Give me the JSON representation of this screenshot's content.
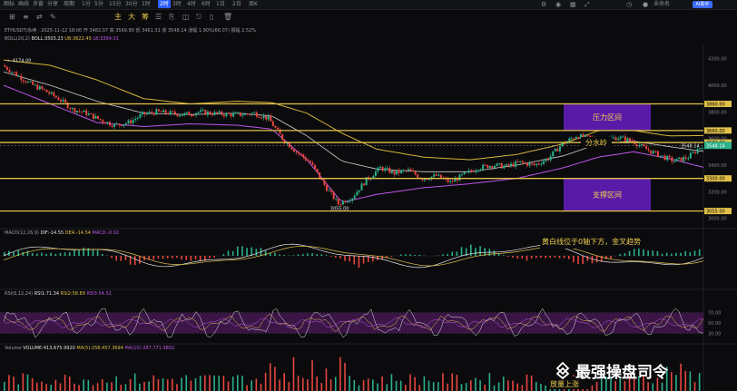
{
  "toolbar": {
    "items": [
      "图标",
      "画线",
      "多窗",
      "分享",
      "周期",
      "1分",
      "5分",
      "15分",
      "30分",
      "1时",
      "2时",
      "3时",
      "4时",
      "6时",
      "1日",
      "2日",
      "周K"
    ],
    "selected_index": 10,
    "account_label": "未命名",
    "chip_label": "AI助手"
  },
  "icon_bar": [
    "⊞",
    "≡",
    "⇄",
    "✎",
    "主",
    "大",
    "筹",
    "☰",
    "⎘",
    "◫",
    "⎋",
    "▯",
    "🗑"
  ],
  "legend": {
    "main_line": "ETHUSDT/永续 · 2025-11-12 18:00  开 3482.07  高 3569.80  低 3461.31  收 3548.14  涨幅 1.90%(66.07)  振幅 2.52%",
    "boll_name": "BOLL(20,2)",
    "boll_mid": "BOLL:3503.23",
    "boll_up": "UB:3622.45",
    "boll_dn": "LB:3384.01",
    "macd_name": "MACD(12,26,9)",
    "macd_dif": "DIF:-14.55",
    "macd_dea": "DEA:-14.54",
    "macd_hist": "MACD:-0.02",
    "rsi_name": "RSI(6,12,24)",
    "rsi1": "RSI1:71.34",
    "rsi2": "RSI2:58.89",
    "rsi3": "RSI3:54.52",
    "vol_name": "Volume",
    "vol_main": "VOLUME:413,675.9920",
    "vol_ma1": "MA(5):258,457.3694",
    "vol_ma2": "MA(10):287,771.9802"
  },
  "annotations": {
    "resistance_zone": "压力区间",
    "watershed": "分水岭",
    "support_zone": "支撑区间",
    "macd_note": "黄白线位于0轴下方，金叉趋势",
    "volume_note": "放量上涨",
    "high_label": "4174.00",
    "low_label": "3055.00"
  },
  "price_axis": {
    "ticks": [
      "4200.00",
      "4000.00",
      "3800.00",
      "3600.00",
      "3400.00",
      "3200.00",
      "3000.00"
    ],
    "level_labels": [
      "3860.00",
      "3660.00",
      "3570.00",
      "3300.00",
      "3055.00"
    ],
    "current_price": "3548.14",
    "current_marker": "3548.14"
  },
  "rsi_axis": {
    "ticks": [
      "70.00",
      "50.00",
      "30.00"
    ]
  },
  "watermark": "最强操盘司令",
  "colors": {
    "up": "#2bb08a",
    "down": "#e8463f",
    "level": "#e2c14a",
    "zone": "#5a1aa8",
    "boll_mid": "#d0d0d0",
    "boll_band": "#d4b43a",
    "boll_lb": "#c055e8",
    "rsi_band": "#3a1546"
  },
  "chart_data": {
    "type": "candlestick",
    "title": "ETHUSDT/永续",
    "ylim": [
      2950,
      4300
    ],
    "levels": [
      3860,
      3660,
      3570,
      3300,
      3055
    ],
    "resistance_zone": [
      3660,
      3860
    ],
    "support_zone": [
      3055,
      3300
    ],
    "watershed": 3570,
    "current_price": 3548.14,
    "trend_close": [
      [
        0,
        4150
      ],
      [
        6,
        4080
      ],
      [
        12,
        4010
      ],
      [
        18,
        3960
      ],
      [
        24,
        3900
      ],
      [
        30,
        3820
      ],
      [
        36,
        3790
      ],
      [
        42,
        3740
      ],
      [
        48,
        3700
      ],
      [
        54,
        3720
      ],
      [
        60,
        3780
      ],
      [
        66,
        3800
      ],
      [
        72,
        3790
      ],
      [
        78,
        3780
      ],
      [
        84,
        3800
      ],
      [
        90,
        3790
      ],
      [
        96,
        3780
      ],
      [
        102,
        3780
      ],
      [
        108,
        3790
      ],
      [
        114,
        3750
      ],
      [
        120,
        3600
      ],
      [
        126,
        3500
      ],
      [
        132,
        3420
      ],
      [
        138,
        3250
      ],
      [
        144,
        3110
      ],
      [
        150,
        3160
      ],
      [
        156,
        3290
      ],
      [
        162,
        3380
      ],
      [
        168,
        3340
      ],
      [
        174,
        3360
      ],
      [
        180,
        3300
      ],
      [
        186,
        3320
      ],
      [
        192,
        3270
      ],
      [
        198,
        3330
      ],
      [
        204,
        3380
      ],
      [
        210,
        3400
      ],
      [
        216,
        3390
      ],
      [
        222,
        3420
      ],
      [
        228,
        3400
      ],
      [
        234,
        3450
      ],
      [
        240,
        3560
      ],
      [
        246,
        3620
      ],
      [
        252,
        3600
      ],
      [
        258,
        3590
      ],
      [
        264,
        3610
      ],
      [
        270,
        3580
      ],
      [
        276,
        3520
      ],
      [
        282,
        3470
      ],
      [
        288,
        3430
      ],
      [
        294,
        3460
      ],
      [
        300,
        3548
      ]
    ],
    "boll_ub_trend": [
      [
        0,
        4190
      ],
      [
        20,
        4150
      ],
      [
        40,
        4040
      ],
      [
        60,
        3900
      ],
      [
        80,
        3860
      ],
      [
        100,
        3880
      ],
      [
        115,
        3870
      ],
      [
        130,
        3790
      ],
      [
        145,
        3640
      ],
      [
        160,
        3520
      ],
      [
        180,
        3460
      ],
      [
        200,
        3440
      ],
      [
        220,
        3480
      ],
      [
        240,
        3560
      ],
      [
        255,
        3660
      ],
      [
        270,
        3660
      ],
      [
        285,
        3620
      ],
      [
        300,
        3622
      ]
    ],
    "boll_mid_trend": [
      [
        0,
        4100
      ],
      [
        20,
        4000
      ],
      [
        40,
        3880
      ],
      [
        60,
        3790
      ],
      [
        80,
        3780
      ],
      [
        100,
        3790
      ],
      [
        115,
        3770
      ],
      [
        130,
        3620
      ],
      [
        145,
        3430
      ],
      [
        160,
        3370
      ],
      [
        180,
        3350
      ],
      [
        200,
        3350
      ],
      [
        220,
        3400
      ],
      [
        240,
        3470
      ],
      [
        255,
        3560
      ],
      [
        270,
        3580
      ],
      [
        285,
        3540
      ],
      [
        300,
        3503
      ]
    ],
    "boll_lb_trend": [
      [
        0,
        4000
      ],
      [
        20,
        3860
      ],
      [
        40,
        3720
      ],
      [
        60,
        3690
      ],
      [
        80,
        3710
      ],
      [
        100,
        3700
      ],
      [
        115,
        3670
      ],
      [
        130,
        3440
      ],
      [
        145,
        3120
      ],
      [
        160,
        3180
      ],
      [
        180,
        3230
      ],
      [
        200,
        3260
      ],
      [
        220,
        3300
      ],
      [
        240,
        3380
      ],
      [
        255,
        3460
      ],
      [
        270,
        3500
      ],
      [
        285,
        3450
      ],
      [
        300,
        3384
      ]
    ],
    "macd_dif": -14.55,
    "macd_dea": -14.54,
    "macd_hist": -0.02,
    "rsi": [
      71.34,
      58.89,
      54.52
    ],
    "rsi_ylim": [
      20,
      80
    ],
    "volume": 413675.992,
    "volume_ma5": 258457.3694,
    "volume_ma10": 287771.9802
  }
}
